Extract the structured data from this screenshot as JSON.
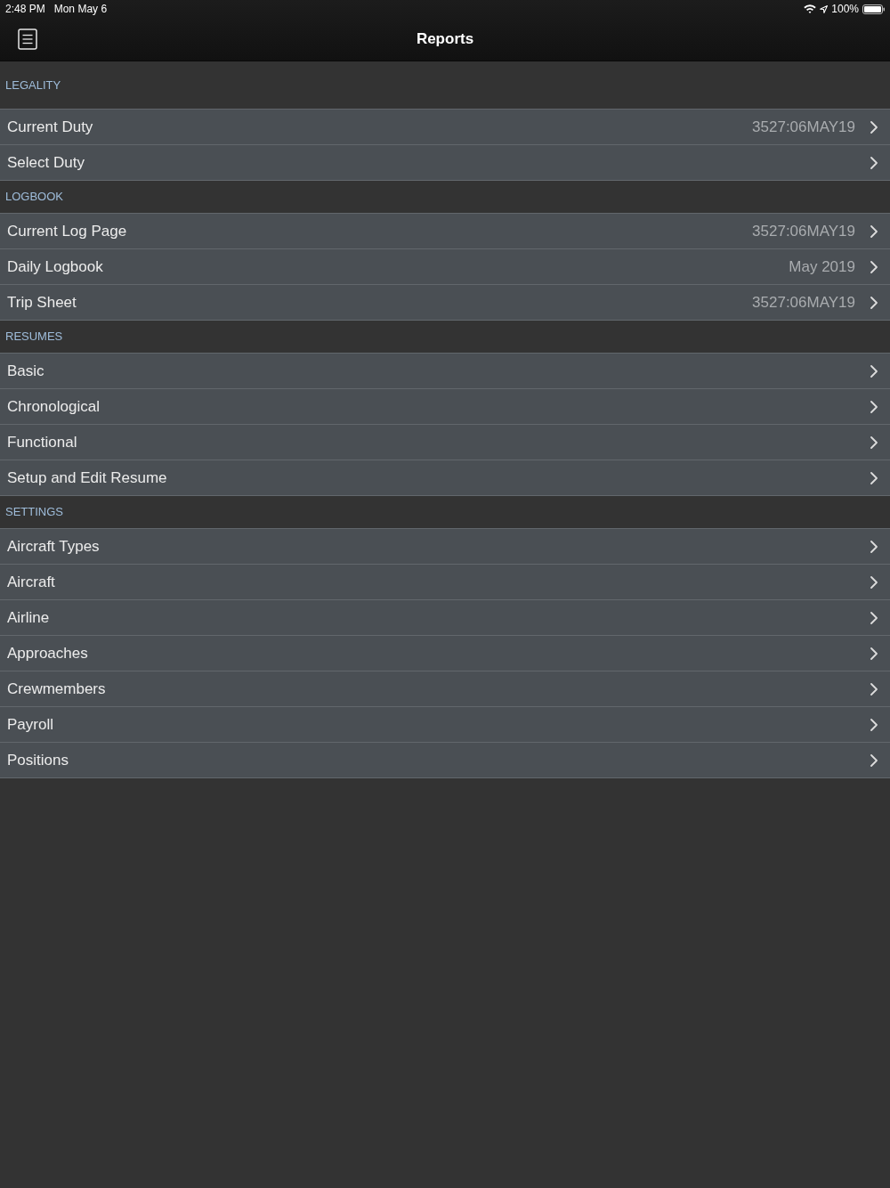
{
  "status_bar": {
    "time": "2:48 PM",
    "date": "Mon May 6",
    "battery": "100%"
  },
  "nav_bar": {
    "title": "Reports"
  },
  "sections": [
    {
      "title": "LEGALITY",
      "rows": [
        {
          "label": "Current Duty",
          "detail": "3527:06MAY19"
        },
        {
          "label": "Select Duty"
        }
      ]
    },
    {
      "title": "LOGBOOK",
      "rows": [
        {
          "label": "Current Log Page",
          "detail": "3527:06MAY19"
        },
        {
          "label": "Daily Logbook",
          "detail": "May 2019"
        },
        {
          "label": "Trip Sheet",
          "detail": "3527:06MAY19"
        }
      ]
    },
    {
      "title": "RESUMES",
      "rows": [
        {
          "label": "Basic"
        },
        {
          "label": "Chronological"
        },
        {
          "label": "Functional"
        },
        {
          "label": "Setup and Edit Resume"
        }
      ]
    },
    {
      "title": "SETTINGS",
      "rows": [
        {
          "label": "Aircraft Types"
        },
        {
          "label": "Aircraft"
        },
        {
          "label": "Airline"
        },
        {
          "label": "Approaches"
        },
        {
          "label": "Crewmembers"
        },
        {
          "label": "Payroll"
        },
        {
          "label": "Positions"
        }
      ]
    }
  ]
}
